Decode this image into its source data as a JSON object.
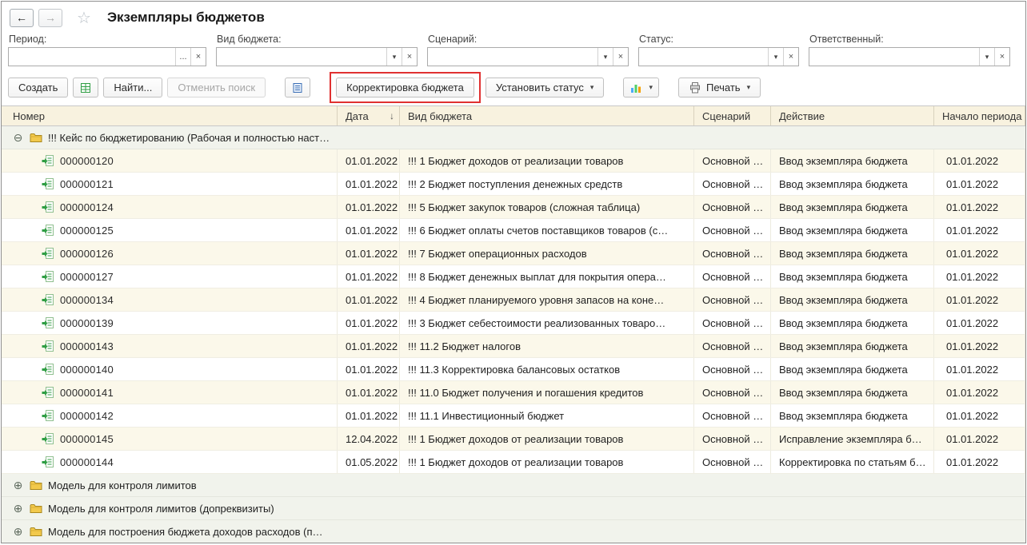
{
  "header": {
    "title": "Экземпляры бюджетов"
  },
  "icons": {
    "back": "←",
    "forward": "→",
    "star": "☆",
    "expanded": "⊖",
    "collapsed": "⊕",
    "sort_desc": "↓",
    "caret": "▾",
    "ellipsis": "...",
    "clear": "×"
  },
  "filters": [
    {
      "label": "Период:",
      "value": ""
    },
    {
      "label": "Вид бюджета:",
      "value": ""
    },
    {
      "label": "Сценарий:",
      "value": ""
    },
    {
      "label": "Статус:",
      "value": ""
    },
    {
      "label": "Ответственный:",
      "value": ""
    }
  ],
  "toolbar": {
    "create_label": "Создать",
    "find_label": "Найти...",
    "cancel_search_label": "Отменить поиск",
    "adjustment_label": "Корректировка бюджета",
    "set_status_label": "Установить статус",
    "print_label": "Печать"
  },
  "table": {
    "columns": [
      "Номер",
      "Дата",
      "Вид бюджета",
      "Сценарий",
      "Действие",
      "Начало периода"
    ],
    "sorted_column": "Дата",
    "group_top": "!!! Кейс по бюджетированию (Рабочая и полностью наст…",
    "rows": [
      {
        "num": "000000120",
        "date": "01.01.2022",
        "type": "!!! 1 Бюджет доходов от реализации товаров",
        "scenario": "Основной …",
        "action": "Ввод экземпляра бюджета",
        "start": "01.01.2022"
      },
      {
        "num": "000000121",
        "date": "01.01.2022",
        "type": "!!! 2 Бюджет поступления денежных средств",
        "scenario": "Основной …",
        "action": "Ввод экземпляра бюджета",
        "start": "01.01.2022"
      },
      {
        "num": "000000124",
        "date": "01.01.2022",
        "type": "!!! 5 Бюджет закупок товаров (сложная таблица)",
        "scenario": "Основной …",
        "action": "Ввод экземпляра бюджета",
        "start": "01.01.2022"
      },
      {
        "num": "000000125",
        "date": "01.01.2022",
        "type": "!!! 6 Бюджет оплаты счетов поставщиков товаров (с…",
        "scenario": "Основной …",
        "action": "Ввод экземпляра бюджета",
        "start": "01.01.2022"
      },
      {
        "num": "000000126",
        "date": "01.01.2022",
        "type": "!!! 7 Бюджет операционных расходов",
        "scenario": "Основной …",
        "action": "Ввод экземпляра бюджета",
        "start": "01.01.2022"
      },
      {
        "num": "000000127",
        "date": "01.01.2022",
        "type": "!!! 8 Бюджет денежных выплат для покрытия опера…",
        "scenario": "Основной …",
        "action": "Ввод экземпляра бюджета",
        "start": "01.01.2022"
      },
      {
        "num": "000000134",
        "date": "01.01.2022",
        "type": "!!! 4 Бюджет планируемого уровня запасов на коне…",
        "scenario": "Основной …",
        "action": "Ввод экземпляра бюджета",
        "start": "01.01.2022"
      },
      {
        "num": "000000139",
        "date": "01.01.2022",
        "type": "!!! 3 Бюджет себестоимости реализованных товаро…",
        "scenario": "Основной …",
        "action": "Ввод экземпляра бюджета",
        "start": "01.01.2022"
      },
      {
        "num": "000000143",
        "date": "01.01.2022",
        "type": "!!! 11.2  Бюджет налогов",
        "scenario": "Основной …",
        "action": "Ввод экземпляра бюджета",
        "start": "01.01.2022"
      },
      {
        "num": "000000140",
        "date": "01.01.2022",
        "type": "!!! 11.3 Корректировка балансовых остатков",
        "scenario": "Основной …",
        "action": "Ввод экземпляра бюджета",
        "start": "01.01.2022"
      },
      {
        "num": "000000141",
        "date": "01.01.2022",
        "type": "!!! 11.0  Бюджет получения и погашения кредитов",
        "scenario": "Основной …",
        "action": "Ввод экземпляра бюджета",
        "start": "01.01.2022"
      },
      {
        "num": "000000142",
        "date": "01.01.2022",
        "type": "!!! 11.1 Инвестиционный бюджет",
        "scenario": "Основной …",
        "action": "Ввод экземпляра бюджета",
        "start": "01.01.2022"
      },
      {
        "num": "000000145",
        "date": "12.04.2022",
        "type": "!!! 1 Бюджет доходов от реализации товаров",
        "scenario": "Основной …",
        "action": "Исправление экземпляра б…",
        "start": "01.01.2022"
      },
      {
        "num": "000000144",
        "date": "01.05.2022",
        "type": "!!! 1 Бюджет доходов от реализации товаров",
        "scenario": "Основной …",
        "action": "Корректировка по статьям б…",
        "start": "01.01.2022"
      }
    ],
    "groups_bottom": [
      "Модель для контроля лимитов",
      "Модель для контроля лимитов (допреквизиты)",
      "Модель для построения бюджета доходов расходов (п…"
    ]
  }
}
